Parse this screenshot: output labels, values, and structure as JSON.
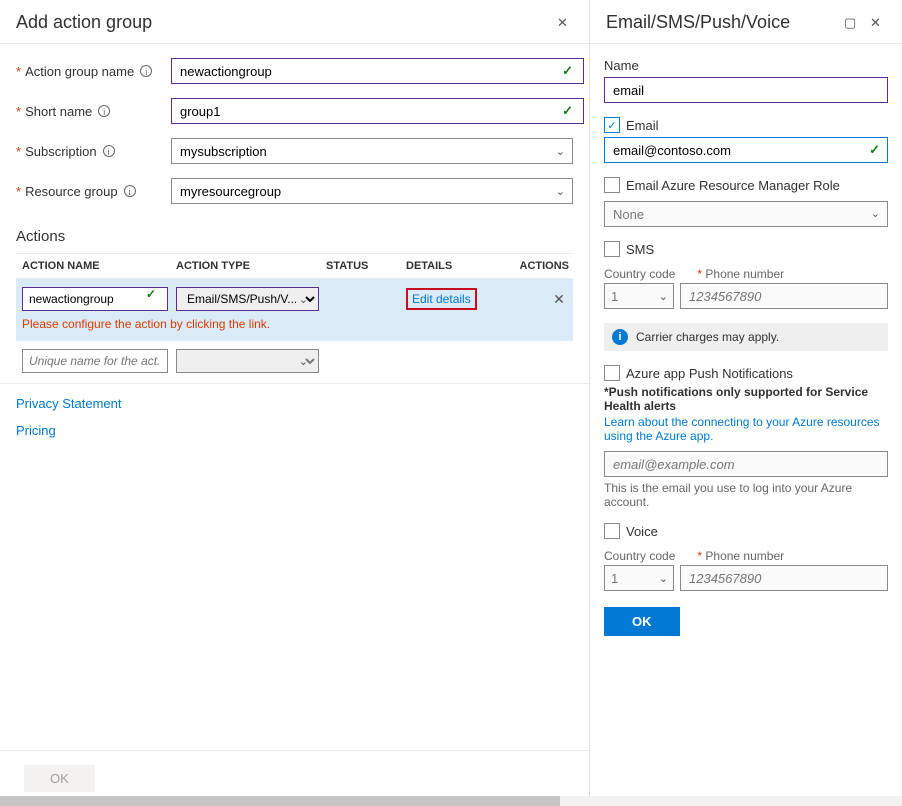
{
  "left": {
    "title": "Add action group",
    "fields": {
      "action_group_name": {
        "label": "Action group name",
        "value": "newactiongroup"
      },
      "short_name": {
        "label": "Short name",
        "value": "group1"
      },
      "subscription": {
        "label": "Subscription",
        "value": "mysubscription"
      },
      "resource_group": {
        "label": "Resource group",
        "value": "myresourcegroup"
      }
    },
    "actions_title": "Actions",
    "table": {
      "headers": {
        "name": "ACTION NAME",
        "type": "ACTION TYPE",
        "status": "STATUS",
        "details": "DETAILS",
        "actions": "ACTIONS"
      },
      "row1": {
        "name": "newactiongroup",
        "type": "Email/SMS/Push/V...",
        "details": "Edit details"
      },
      "warning": "Please configure the action by clicking the link.",
      "empty_placeholder": "Unique name for the act..."
    },
    "links": {
      "privacy": "Privacy Statement",
      "pricing": "Pricing"
    },
    "ok_label": "OK"
  },
  "right": {
    "title": "Email/SMS/Push/Voice",
    "name": {
      "label": "Name",
      "value": "email"
    },
    "email": {
      "label": "Email",
      "value": "email@contoso.com"
    },
    "arm": {
      "label": "Email Azure Resource Manager Role",
      "value": "None"
    },
    "sms": {
      "label": "SMS",
      "country_label": "Country code",
      "phone_label": "Phone number",
      "cc": "1",
      "placeholder": "1234567890"
    },
    "banner": "Carrier charges may apply.",
    "push": {
      "label": "Azure app Push Notifications",
      "note": "*Push notifications only supported for Service Health alerts",
      "link": "Learn about the connecting to your Azure resources using the Azure app.",
      "placeholder": "email@example.com",
      "help": "This is the email you use to log into your Azure account."
    },
    "voice": {
      "label": "Voice",
      "country_label": "Country code",
      "phone_label": "Phone number",
      "cc": "1",
      "placeholder": "1234567890"
    },
    "ok_label": "OK"
  }
}
